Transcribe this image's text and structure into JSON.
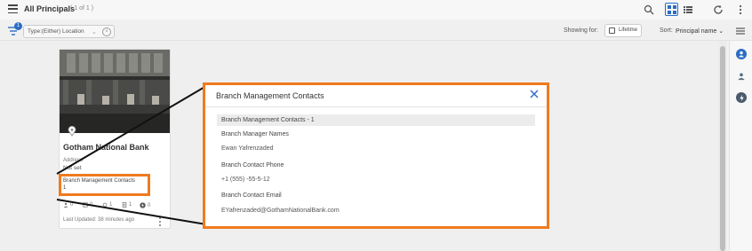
{
  "header": {
    "title": "All Principals",
    "count": "( 1 of 1 )"
  },
  "filterbar": {
    "badge": "1",
    "chip_label": "Type:(Either) Location",
    "showing_label": "Showing for:",
    "lifetime_label": "Lifetime",
    "sort_label": "Sort:",
    "sort_value": "Principal name ⌄"
  },
  "card": {
    "bank_name": "Gotham National Bank",
    "address_label": "Address",
    "address_value": "Not set",
    "contacts_label": "Branch Management Contacts",
    "contacts_count": "1",
    "stats": [
      "0",
      "0",
      "1",
      "1",
      "0"
    ],
    "updated": "Last Updated: 38 minutes ago"
  },
  "modal": {
    "title": "Branch Management Contacts",
    "section": "Branch Management Contacts - 1",
    "manager_label": "Branch Manager Names",
    "manager_value": "Ewan Yafrenzaded",
    "phone_label": "Branch Contact Phone",
    "phone_value": "+1 (555) -55-5-12",
    "email_label": "Branch Contact Email",
    "email_value": "EYafrenzaded@GothamNationalBank.com"
  },
  "icons": {
    "menu": "hamburger-icon",
    "search": "search-icon",
    "grid": "grid-view-icon",
    "list": "list-view-icon",
    "refresh": "refresh-icon",
    "more": "more-vertical-icon",
    "filter": "filter-icon",
    "calendar": "calendar-icon",
    "collapse": "collapse-panel-icon",
    "rail": [
      "person-circle-icon",
      "person-icon",
      "lightning-icon"
    ]
  },
  "colors": {
    "accent": "#2b6cc4",
    "highlight": "#f07a1e"
  }
}
